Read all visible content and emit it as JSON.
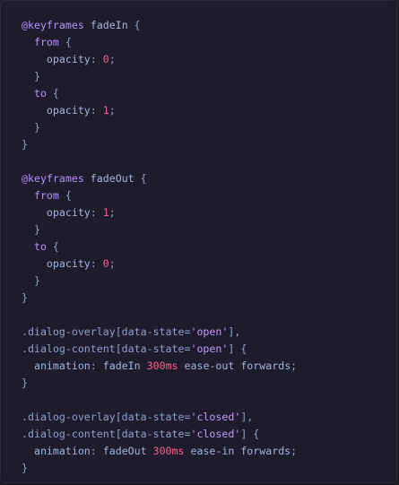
{
  "code_block": {
    "language": "css",
    "colors": {
      "background": "#1d1b2c",
      "keyword": "#b592ff",
      "text": "#a6b5dc",
      "number": "#ff5f8f",
      "string": "#c49bff"
    },
    "lines": [
      [
        {
          "t": "kw",
          "v": "@keyframes"
        },
        {
          "t": "name",
          "v": " fadeIn "
        },
        {
          "t": "punc",
          "v": "{"
        }
      ],
      [
        {
          "t": "kw",
          "v": "  from"
        },
        {
          "t": "punc",
          "v": " {"
        }
      ],
      [
        {
          "t": "prop",
          "v": "    opacity"
        },
        {
          "t": "punc",
          "v": ": "
        },
        {
          "t": "num",
          "v": "0"
        },
        {
          "t": "punc",
          "v": ";"
        }
      ],
      [
        {
          "t": "punc",
          "v": "  }"
        }
      ],
      [
        {
          "t": "kw",
          "v": "  to"
        },
        {
          "t": "punc",
          "v": " {"
        }
      ],
      [
        {
          "t": "prop",
          "v": "    opacity"
        },
        {
          "t": "punc",
          "v": ": "
        },
        {
          "t": "num",
          "v": "1"
        },
        {
          "t": "punc",
          "v": ";"
        }
      ],
      [
        {
          "t": "punc",
          "v": "  }"
        }
      ],
      [
        {
          "t": "punc",
          "v": "}"
        }
      ],
      [],
      [
        {
          "t": "kw",
          "v": "@keyframes"
        },
        {
          "t": "name",
          "v": " fadeOut "
        },
        {
          "t": "punc",
          "v": "{"
        }
      ],
      [
        {
          "t": "kw",
          "v": "  from"
        },
        {
          "t": "punc",
          "v": " {"
        }
      ],
      [
        {
          "t": "prop",
          "v": "    opacity"
        },
        {
          "t": "punc",
          "v": ": "
        },
        {
          "t": "num",
          "v": "1"
        },
        {
          "t": "punc",
          "v": ";"
        }
      ],
      [
        {
          "t": "punc",
          "v": "  }"
        }
      ],
      [
        {
          "t": "kw",
          "v": "  to"
        },
        {
          "t": "punc",
          "v": " {"
        }
      ],
      [
        {
          "t": "prop",
          "v": "    opacity"
        },
        {
          "t": "punc",
          "v": ": "
        },
        {
          "t": "num",
          "v": "0"
        },
        {
          "t": "punc",
          "v": ";"
        }
      ],
      [
        {
          "t": "punc",
          "v": "  }"
        }
      ],
      [
        {
          "t": "punc",
          "v": "}"
        }
      ],
      [],
      [
        {
          "t": "sel",
          "v": ".dialog-overlay[data-state="
        },
        {
          "t": "str",
          "v": "'open'"
        },
        {
          "t": "sel",
          "v": "],"
        }
      ],
      [
        {
          "t": "sel",
          "v": ".dialog-content[data-state="
        },
        {
          "t": "str",
          "v": "'open'"
        },
        {
          "t": "sel",
          "v": "] {"
        }
      ],
      [
        {
          "t": "prop",
          "v": "  animation"
        },
        {
          "t": "punc",
          "v": ": "
        },
        {
          "t": "val",
          "v": "fadeIn "
        },
        {
          "t": "num",
          "v": "300ms"
        },
        {
          "t": "val",
          "v": " ease-out forwards"
        },
        {
          "t": "punc",
          "v": ";"
        }
      ],
      [
        {
          "t": "punc",
          "v": "}"
        }
      ],
      [],
      [
        {
          "t": "sel",
          "v": ".dialog-overlay[data-state="
        },
        {
          "t": "str",
          "v": "'closed'"
        },
        {
          "t": "sel",
          "v": "],"
        }
      ],
      [
        {
          "t": "sel",
          "v": ".dialog-content[data-state="
        },
        {
          "t": "str",
          "v": "'closed'"
        },
        {
          "t": "sel",
          "v": "] {"
        }
      ],
      [
        {
          "t": "prop",
          "v": "  animation"
        },
        {
          "t": "punc",
          "v": ": "
        },
        {
          "t": "val",
          "v": "fadeOut "
        },
        {
          "t": "num",
          "v": "300ms"
        },
        {
          "t": "val",
          "v": " ease-in forwards"
        },
        {
          "t": "punc",
          "v": ";"
        }
      ],
      [
        {
          "t": "punc",
          "v": "}"
        }
      ]
    ]
  }
}
